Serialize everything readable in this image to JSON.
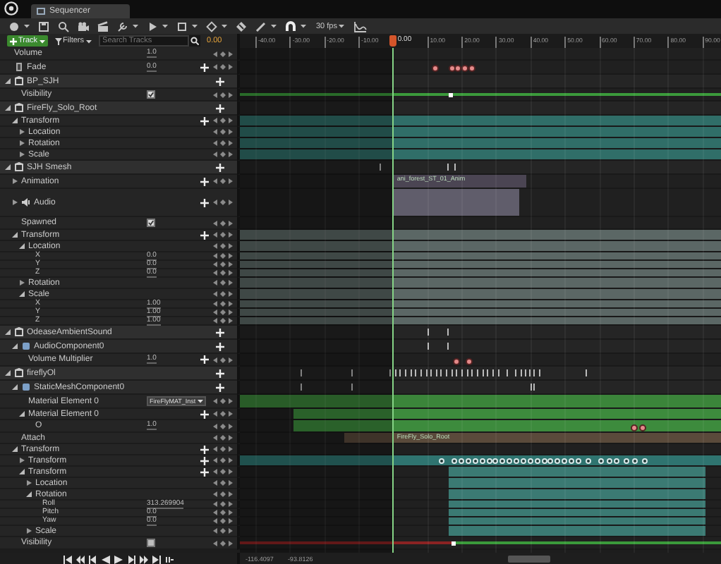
{
  "window": {
    "tab": "Sequencer"
  },
  "toolbar": {
    "fps": "30 fps"
  },
  "track_bar": {
    "add_track": "Track",
    "filters": "Filters",
    "search": {
      "placeholder": "Search Tracks"
    },
    "current_time": "0.00"
  },
  "ruler": {
    "ticks": [
      "-40.00",
      "-30.00",
      "-20.00",
      "-10.00",
      "10.00",
      "20.00",
      "30.00",
      "40.00",
      "50.00",
      "60.00",
      "70.00",
      "80.00",
      "90.00"
    ],
    "playhead": "0.00"
  },
  "rows": [
    {
      "kind": "property",
      "label": "Volume",
      "value": "1.0"
    },
    {
      "kind": "fade",
      "label": "Fade",
      "value": "0.0",
      "add": true,
      "lane": {
        "kind": "event"
      }
    },
    {
      "kind": "object",
      "label": "BP_SJH",
      "expanded": true,
      "add": true,
      "children": [
        {
          "kind": "bool",
          "label": "Visibility",
          "checked": true,
          "lane": {
            "kind": "bool",
            "states": [
              true,
              true
            ]
          }
        }
      ]
    },
    {
      "kind": "object",
      "label": "FireFly_Solo_Root",
      "expanded": true,
      "add": true,
      "children": [
        {
          "kind": "group",
          "label": "Transform",
          "expanded": true,
          "add": true,
          "lane": {
            "kind": "section",
            "color": "#306e68"
          },
          "children": [
            {
              "kind": "group",
              "label": "Location",
              "expanded": false,
              "lane": {
                "kind": "section",
                "color": "#306e68"
              }
            },
            {
              "kind": "group",
              "label": "Rotation",
              "expanded": false,
              "lane": {
                "kind": "section",
                "color": "#306e68"
              }
            },
            {
              "kind": "group",
              "label": "Scale",
              "expanded": false,
              "lane": {
                "kind": "section",
                "color": "#306e68"
              }
            }
          ]
        }
      ]
    },
    {
      "kind": "object",
      "label": "SJH Smesh",
      "expanded": true,
      "add": true,
      "lane": {
        "kind": "ticks"
      },
      "children": [
        {
          "kind": "animation",
          "label": "Animation",
          "expanded": false,
          "add": true,
          "lane": {
            "kind": "section",
            "color": "#4b4553",
            "label": "ani_forest_ST_01_Anim"
          }
        },
        {
          "kind": "audio",
          "label": "Audio",
          "expanded": false,
          "add": true,
          "lane": {
            "kind": "section",
            "color": "#605d6b"
          }
        },
        {
          "kind": "bool",
          "label": "Spawned",
          "checked": true
        },
        {
          "kind": "group",
          "label": "Transform",
          "expanded": true,
          "add": true,
          "lane": {
            "kind": "section",
            "color": "#5b6765"
          },
          "children": [
            {
              "kind": "group",
              "label": "Location",
              "expanded": true,
              "lane": {
                "kind": "section",
                "color": "#5b6765"
              },
              "children": [
                {
                  "kind": "channel",
                  "label": "X",
                  "value": "0.0",
                  "lane": {
                    "kind": "section",
                    "color": "#5b6765"
                  }
                },
                {
                  "kind": "channel",
                  "label": "Y",
                  "value": "0.0",
                  "lane": {
                    "kind": "section",
                    "color": "#5b6765"
                  }
                },
                {
                  "kind": "channel",
                  "label": "Z",
                  "value": "0.0",
                  "lane": {
                    "kind": "section",
                    "color": "#5b6765"
                  }
                }
              ]
            },
            {
              "kind": "group",
              "label": "Rotation",
              "expanded": false,
              "lane": {
                "kind": "section",
                "color": "#5b6765"
              }
            },
            {
              "kind": "group",
              "label": "Scale",
              "expanded": true,
              "lane": {
                "kind": "section",
                "color": "#5b6765"
              },
              "children": [
                {
                  "kind": "channel",
                  "label": "X",
                  "value": "1.00",
                  "lane": {
                    "kind": "section",
                    "color": "#5b6765"
                  }
                },
                {
                  "kind": "channel",
                  "label": "Y",
                  "value": "1.00",
                  "lane": {
                    "kind": "section",
                    "color": "#5b6765"
                  }
                },
                {
                  "kind": "channel",
                  "label": "Z",
                  "value": "1.00",
                  "lane": {
                    "kind": "section",
                    "color": "#5b6765"
                  }
                }
              ]
            }
          ]
        }
      ]
    },
    {
      "kind": "object",
      "label": "OdeaseAmbientSound",
      "expanded": true,
      "add": true,
      "lane": {
        "kind": "ticks"
      },
      "children": [
        {
          "kind": "component",
          "label": "AudioComponent0",
          "expanded": true,
          "add": true,
          "lane": {
            "kind": "ticks"
          },
          "children": [
            {
              "kind": "property",
              "label": "Volume Multiplier",
              "value": "1.0",
              "add": true,
              "lane": {
                "kind": "event"
              }
            }
          ]
        }
      ]
    },
    {
      "kind": "object",
      "label": "fireflyOl",
      "expanded": true,
      "add": true,
      "lane": {
        "kind": "ticks"
      },
      "children": [
        {
          "kind": "component",
          "label": "StaticMeshComponent0",
          "expanded": true,
          "add": true,
          "lane": {
            "kind": "ticks"
          },
          "children": [
            {
              "kind": "dropdown",
              "label": "Material Element 0",
              "value": "FireFlyMAT_Inst",
              "lane": {
                "kind": "section",
                "color": "#3b853a"
              }
            },
            {
              "kind": "group",
              "label": "Material Element 0",
              "expanded": true,
              "add": true,
              "lane": {
                "kind": "section",
                "color": "#3d8b3d"
              },
              "children": [
                {
                  "kind": "property",
                  "label": "O",
                  "value": "1.0",
                  "lane": {
                    "kind": "event",
                    "color": "#3d8b3d"
                  }
                }
              ]
            }
          ]
        },
        {
          "kind": "attach",
          "label": "Attach",
          "lane": {
            "kind": "section",
            "color": "#5a4a3b",
            "label": "FireFly_Solo_Root"
          }
        },
        {
          "kind": "group",
          "label": "Transform",
          "expanded": true,
          "add": true,
          "children": [
            {
              "kind": "group",
              "label": "Transform",
              "expanded": false,
              "add": true,
              "lane": {
                "kind": "transform",
                "color": "#2f7470"
              }
            },
            {
              "kind": "group",
              "label": "Transform",
              "expanded": true,
              "add": true,
              "lane": {
                "kind": "section",
                "color": "#3b7a73"
              },
              "children": [
                {
                  "kind": "group",
                  "label": "Location",
                  "expanded": false,
                  "lane": {
                    "kind": "section",
                    "color": "#3b7a73"
                  }
                },
                {
                  "kind": "group",
                  "label": "Rotation",
                  "expanded": true,
                  "lane": {
                    "kind": "section",
                    "color": "#3b7a73"
                  },
                  "children": [
                    {
                      "kind": "channel",
                      "label": "Roll",
                      "value": "313.269904",
                      "lane": {
                        "kind": "section",
                        "color": "#3b7a73"
                      }
                    },
                    {
                      "kind": "channel",
                      "label": "Pitch",
                      "value": "0.0",
                      "lane": {
                        "kind": "section",
                        "color": "#3b7a73"
                      }
                    },
                    {
                      "kind": "channel",
                      "label": "Yaw",
                      "value": "0.0",
                      "lane": {
                        "kind": "section",
                        "color": "#3b7a73"
                      }
                    }
                  ]
                },
                {
                  "kind": "group",
                  "label": "Scale",
                  "expanded": false,
                  "lane": {
                    "kind": "section",
                    "color": "#3b7a73"
                  }
                }
              ]
            }
          ]
        },
        {
          "kind": "bool",
          "label": "Visibility",
          "checked": false,
          "lane": {
            "kind": "bool",
            "states": [
              false,
              true
            ]
          }
        }
      ]
    }
  ],
  "bottom": {
    "readouts": [
      "-116.4097",
      "-93.8126"
    ]
  }
}
